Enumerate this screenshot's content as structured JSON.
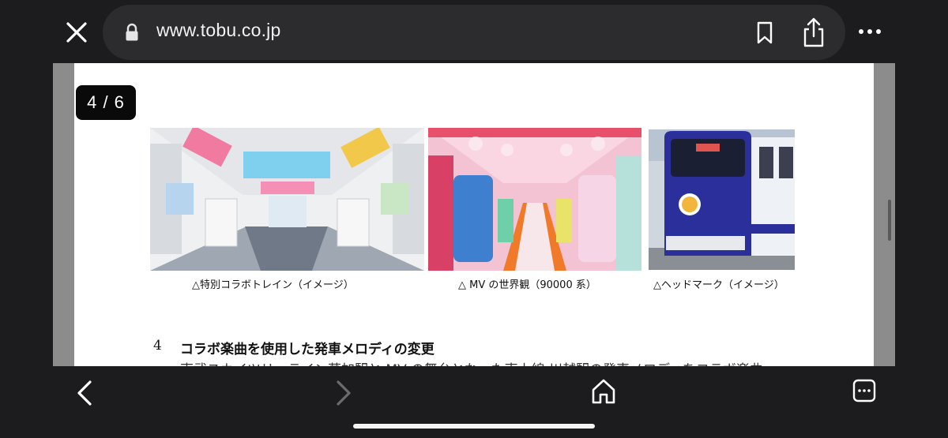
{
  "browser": {
    "url": "www.tobu.co.jp",
    "icons": {
      "close": "close-icon",
      "lock": "lock-icon",
      "bookmark": "bookmark-icon",
      "share": "share-icon",
      "more": "more-icon"
    }
  },
  "viewer": {
    "page_counter": "4 / 6"
  },
  "document": {
    "captions": [
      "△特別コラボトレイン（イメージ）",
      "△ MV の世界観（90000 系）",
      "△ヘッドマーク（イメージ）"
    ],
    "section": {
      "number": "4",
      "title": "コラボ楽曲を使用した発車メロディの変更",
      "partial_line": "東武スカイツリーライン草加駅と MV の舞台となった東上線 川越駅の発車メロディをコラボ楽曲"
    }
  },
  "toolbar": {
    "icons": {
      "back": "chevron-left-icon",
      "forward": "chevron-right-icon",
      "home": "home-icon",
      "tabs": "tabs-icon"
    }
  },
  "colors": {
    "chrome_bg": "#1c1c1e",
    "urlbar_bg": "#2c2c2e",
    "viewer_bg": "#8c8c8c",
    "page_bg": "#ffffff",
    "train_blue": "#2a2f9c"
  }
}
